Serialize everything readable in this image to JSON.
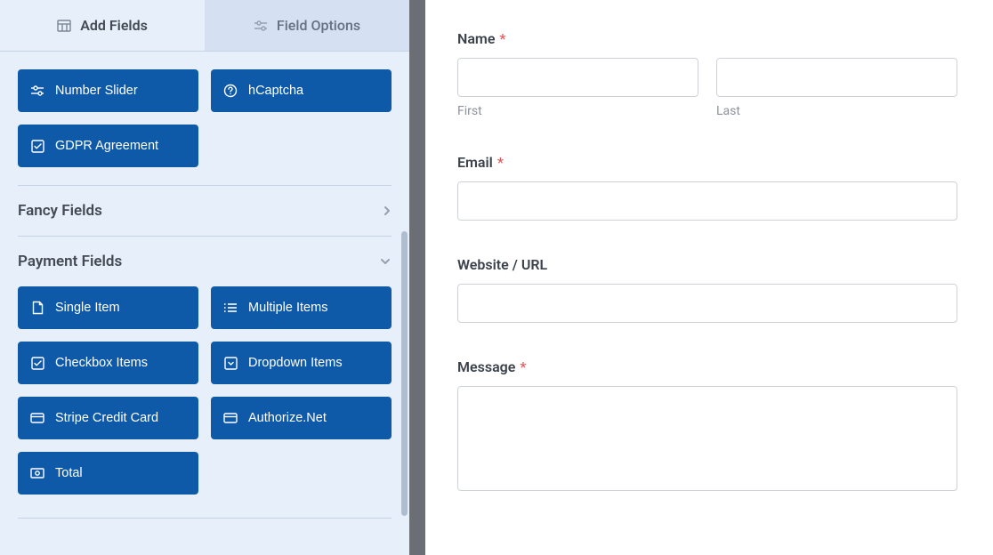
{
  "tabs": {
    "add_fields": "Add Fields",
    "field_options": "Field Options"
  },
  "misc_fields": {
    "number_slider": "Number Slider",
    "hcaptcha": "hCaptcha",
    "gdpr": "GDPR Agreement"
  },
  "sections": {
    "fancy": "Fancy Fields",
    "payment": "Payment Fields"
  },
  "payment_fields": {
    "single_item": "Single Item",
    "multiple_items": "Multiple Items",
    "checkbox_items": "Checkbox Items",
    "dropdown_items": "Dropdown Items",
    "stripe": "Stripe Credit Card",
    "authorize": "Authorize.Net",
    "total": "Total"
  },
  "form": {
    "name_label": "Name",
    "first_sub": "First",
    "last_sub": "Last",
    "email_label": "Email",
    "website_label": "Website / URL",
    "message_label": "Message",
    "required_mark": "*"
  }
}
